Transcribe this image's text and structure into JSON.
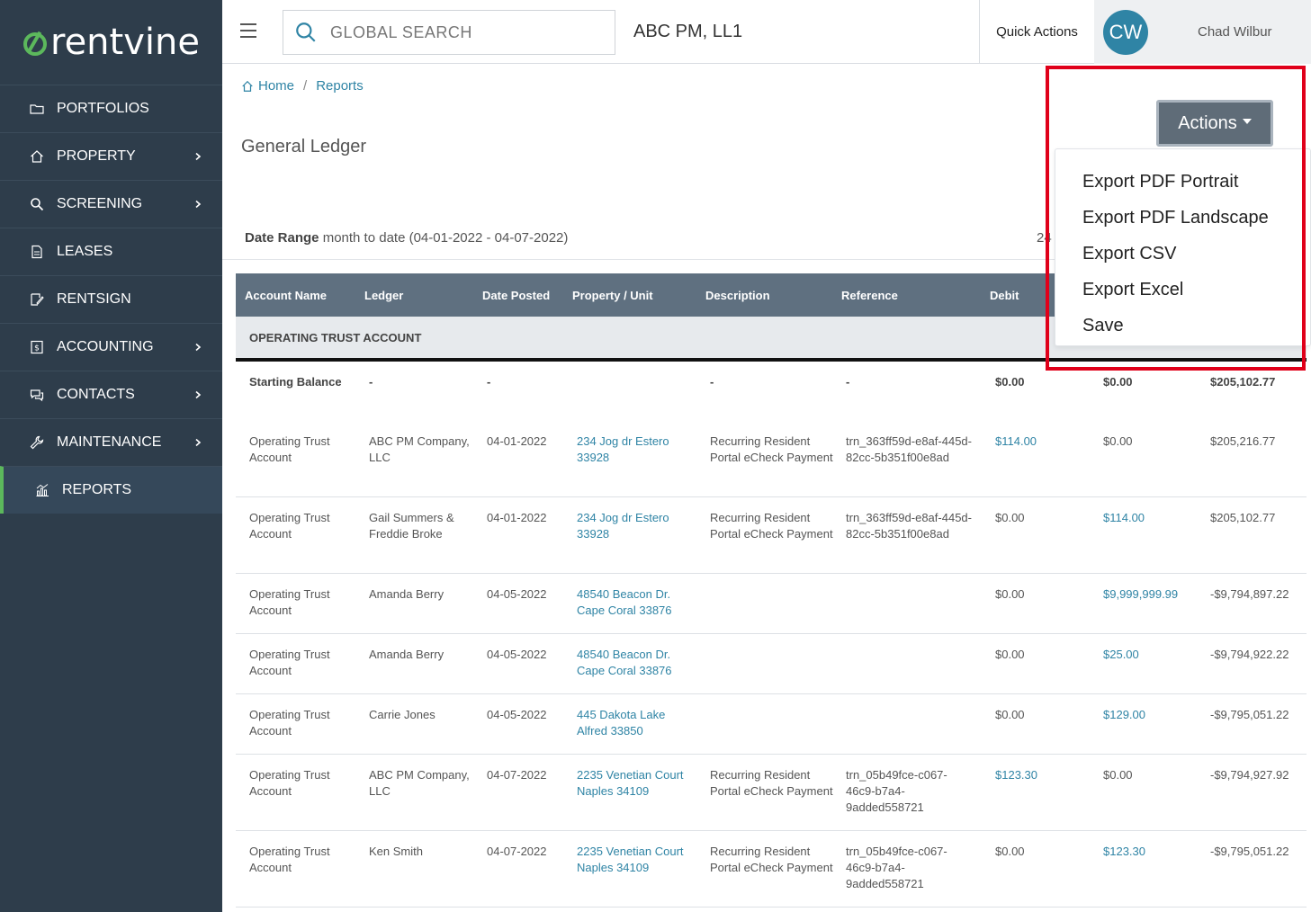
{
  "brand": {
    "name": "rentvine",
    "accent": "#5cb85c"
  },
  "sidebar": {
    "items": [
      {
        "label": "PORTFOLIOS",
        "icon": "folder-icon",
        "has_submenu": false,
        "active": false
      },
      {
        "label": "PROPERTY",
        "icon": "home-icon",
        "has_submenu": true,
        "active": false
      },
      {
        "label": "SCREENING",
        "icon": "search-icon",
        "has_submenu": true,
        "active": false
      },
      {
        "label": "LEASES",
        "icon": "document-icon",
        "has_submenu": false,
        "active": false
      },
      {
        "label": "RENTSIGN",
        "icon": "signature-icon",
        "has_submenu": false,
        "active": false
      },
      {
        "label": "ACCOUNTING",
        "icon": "dollar-icon",
        "has_submenu": true,
        "active": false
      },
      {
        "label": "CONTACTS",
        "icon": "chat-icon",
        "has_submenu": true,
        "active": false
      },
      {
        "label": "MAINTENANCE",
        "icon": "wrench-icon",
        "has_submenu": true,
        "active": false
      },
      {
        "label": "REPORTS",
        "icon": "chart-icon",
        "has_submenu": false,
        "active": true
      }
    ]
  },
  "topbar": {
    "search_placeholder": "GLOBAL SEARCH",
    "company": "ABC PM, LL1",
    "quick_actions": "Quick Actions",
    "user_initials": "CW",
    "user_name": "Chad Wilbur"
  },
  "breadcrumb": {
    "home": "Home",
    "current": "Reports"
  },
  "page_title": "General Ledger",
  "date_range": {
    "label": "Date Range",
    "value": "month to date (04-01-2022 - 04-07-2022)",
    "cut_text": "24"
  },
  "actions": {
    "label": "Actions",
    "menu": [
      "Export PDF Portrait",
      "Export PDF Landscape",
      "Export CSV",
      "Export Excel",
      "Save"
    ]
  },
  "table": {
    "columns": [
      "Account Name",
      "Ledger",
      "Date Posted",
      "Property / Unit",
      "Description",
      "Reference",
      "Debit"
    ],
    "group": "OPERATING TRUST ACCOUNT",
    "starting_balance": {
      "label": "Starting Balance",
      "ledger": "-",
      "date": "-",
      "description": "-",
      "reference": "-",
      "debit": "$0.00",
      "credit": "$0.00",
      "balance": "$205,102.77"
    },
    "rows": [
      {
        "account": "Operating Trust Account",
        "ledger": "ABC PM Company, LLC",
        "date": "04-01-2022",
        "property": "234 Jog dr Estero 33928",
        "description": "Recurring Resident Portal eCheck Payment",
        "reference": "trn_363ff59d-e8af-445d-82cc-5b351f00e8ad",
        "debit": "$114.00",
        "credit": "$0.00",
        "balance": "$205,216.77",
        "debit_link": true,
        "credit_link": false
      },
      {
        "account": "Operating Trust Account",
        "ledger": "Gail Summers & Freddie Broke",
        "date": "04-01-2022",
        "property": "234 Jog dr Estero 33928",
        "description": "Recurring Resident Portal eCheck Payment",
        "reference": "trn_363ff59d-e8af-445d-82cc-5b351f00e8ad",
        "debit": "$0.00",
        "credit": "$114.00",
        "balance": "$205,102.77",
        "debit_link": false,
        "credit_link": true
      },
      {
        "account": "Operating Trust Account",
        "ledger": "Amanda Berry",
        "date": "04-05-2022",
        "property": "48540 Beacon Dr. Cape Coral 33876",
        "description": "",
        "reference": "",
        "debit": "$0.00",
        "credit": "$9,999,999.99",
        "balance": "-$9,794,897.22",
        "debit_link": false,
        "credit_link": true
      },
      {
        "account": "Operating Trust Account",
        "ledger": "Amanda Berry",
        "date": "04-05-2022",
        "property": "48540 Beacon Dr. Cape Coral 33876",
        "description": "",
        "reference": "",
        "debit": "$0.00",
        "credit": "$25.00",
        "balance": "-$9,794,922.22",
        "debit_link": false,
        "credit_link": true
      },
      {
        "account": "Operating Trust Account",
        "ledger": "Carrie Jones",
        "date": "04-05-2022",
        "property": "445 Dakota Lake Alfred 33850",
        "description": "",
        "reference": "",
        "debit": "$0.00",
        "credit": "$129.00",
        "balance": "-$9,795,051.22",
        "debit_link": false,
        "credit_link": true
      },
      {
        "account": "Operating Trust Account",
        "ledger": "ABC PM Company, LLC",
        "date": "04-07-2022",
        "property": "2235 Venetian Court Naples 34109",
        "description": "Recurring Resident Portal eCheck Payment",
        "reference": "trn_05b49fce-c067-46c9-b7a4-9added558721",
        "debit": "$123.30",
        "credit": "$0.00",
        "balance": "-$9,794,927.92",
        "debit_link": true,
        "credit_link": false
      },
      {
        "account": "Operating Trust Account",
        "ledger": "Ken Smith",
        "date": "04-07-2022",
        "property": "2235 Venetian Court Naples 34109",
        "description": "Recurring Resident Portal eCheck Payment",
        "reference": "trn_05b49fce-c067-46c9-b7a4-9added558721",
        "debit": "$0.00",
        "credit": "$123.30",
        "balance": "-$9,795,051.22",
        "debit_link": false,
        "credit_link": true
      }
    ]
  },
  "colors": {
    "sidebar_bg": "#2e3d4b",
    "link": "#2f84a5",
    "header_bg": "#5f7080",
    "highlight": "#e0001a"
  }
}
